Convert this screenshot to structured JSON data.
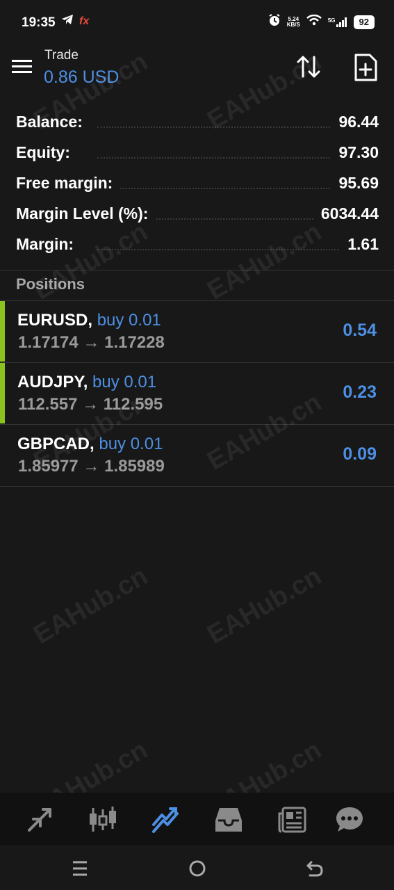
{
  "status_bar": {
    "time": "19:35",
    "app_icon_fx": "fx",
    "net_speed_value": "5.24",
    "net_speed_unit": "KB/S",
    "network": "5G",
    "battery": "92"
  },
  "header": {
    "title": "Trade",
    "subtitle": "0.86 USD"
  },
  "summary": [
    {
      "label": "Balance:",
      "value": "96.44"
    },
    {
      "label": "Equity:",
      "value": "97.30"
    },
    {
      "label": "Free margin:",
      "value": "95.69"
    },
    {
      "label": "Margin Level (%):",
      "value": "6034.44"
    },
    {
      "label": "Margin:",
      "value": "1.61"
    }
  ],
  "positions_header": "Positions",
  "positions": [
    {
      "symbol": "EURUSD,",
      "side": "buy 0.01",
      "prices": "1.17174 → 1.17228",
      "profit": "0.54",
      "has_bar": true
    },
    {
      "symbol": "AUDJPY,",
      "side": "buy 0.01",
      "prices": "112.557 → 112.595",
      "profit": "0.23",
      "has_bar": true
    },
    {
      "symbol": "GBPCAD,",
      "side": "buy 0.01",
      "prices": "1.85977 → 1.85989",
      "profit": "0.09",
      "has_bar": false
    }
  ],
  "bottom_nav": [
    "quotes-icon",
    "chart-icon",
    "trade-icon",
    "history-icon",
    "news-icon",
    "messages-icon"
  ],
  "watermark": "EAHub.cn",
  "colors": {
    "background": "#181818",
    "accent_blue": "#4d8fe4",
    "buy_bar_green": "#8cc21f",
    "muted_text": "#9a9a9a"
  }
}
